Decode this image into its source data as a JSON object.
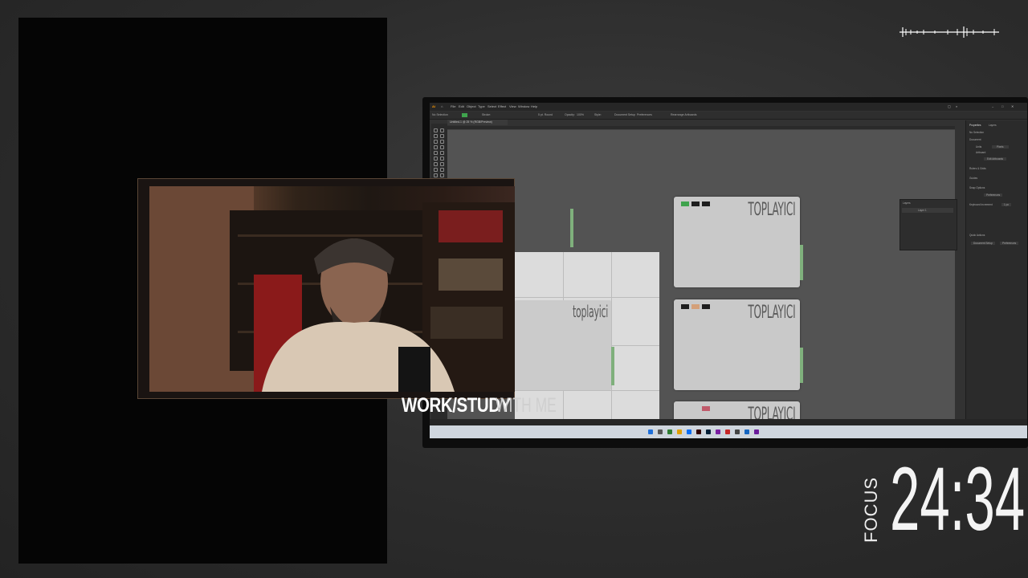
{
  "overlay": {
    "title_bold": "WORK/STUDY",
    "title_light": "WITH ME",
    "timer_label": "FOCUS",
    "timer_value": "24:34"
  },
  "app": {
    "menu": [
      "File",
      "Edit",
      "Object",
      "Type",
      "Select",
      "Effect",
      "View",
      "Window",
      "Help"
    ],
    "document_tab": "Untitled-1 @ 25 % (RGB/Preview)",
    "control_bar": {
      "selection": "No Selection",
      "stroke_label": "Stroke:",
      "brush": "5 pt. Round",
      "opacity_label": "Opacity:",
      "opacity_value": "100%",
      "style_label": "Style:",
      "document_setup": "Document Setup",
      "preferences": "Preferences",
      "rearrange": "Rearrange Artboards"
    },
    "properties_panel": {
      "tab_properties": "Properties",
      "tab_layers": "Layers",
      "no_selection": "No Selection",
      "section_document": "Document",
      "units_label": "Units",
      "units_value": "Pixels",
      "artboard_label": "Artboard",
      "edit_artboards": "Edit Artboards",
      "rulers_grids": "Rulers & Grids",
      "guides": "Guides",
      "snap_options": "Snap Options",
      "preferences_section": "Preferences",
      "keyboard_increment": "Keyboard Increment",
      "keyboard_value": "1 px",
      "quick_actions": "Quick Actions",
      "document_setup_btn": "Document Setup",
      "preferences_btn": "Preferences"
    },
    "layers_panel": {
      "tab": "Layers",
      "layer_name": "Layer 1"
    },
    "artboard_logo": "TOPLAYICI",
    "artboard_logo_small": "toplayici",
    "colors": {
      "green": "#3fa34d",
      "dark": "#1e1e1e",
      "tan": "#d4a07a",
      "pink": "#c05a6a",
      "tab_green": "#7fb07c"
    }
  }
}
